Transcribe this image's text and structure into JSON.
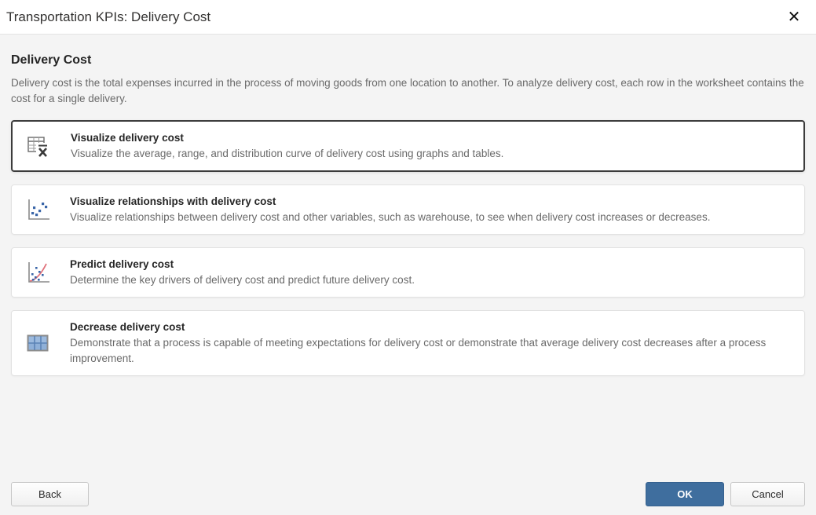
{
  "dialog": {
    "title": "Transportation KPIs: Delivery Cost",
    "close_icon": "close-x"
  },
  "content": {
    "heading": "Delivery Cost",
    "description": "Delivery cost is the total expenses incurred in the process of moving goods from one location to another. To analyze delivery cost, each row in the worksheet contains the cost for a single delivery.",
    "options": [
      {
        "icon": "table-mean-icon",
        "title": "Visualize delivery cost",
        "description": "Visualize the average, range, and distribution curve of delivery cost using graphs and tables.",
        "selected": true
      },
      {
        "icon": "scatter-plot-icon",
        "title": "Visualize relationships with delivery cost",
        "description": "Visualize relationships between delivery cost and other variables, such as warehouse, to see when delivery cost increases or decreases.",
        "selected": false
      },
      {
        "icon": "regression-plot-icon",
        "title": "Predict delivery cost",
        "description": "Determine the key drivers of delivery cost and predict future delivery cost.",
        "selected": false
      },
      {
        "icon": "capability-table-icon",
        "title": "Decrease delivery cost",
        "description": "Demonstrate that a process is capable of meeting expectations for delivery cost or demonstrate that average delivery cost decreases after a process improvement.",
        "selected": false
      }
    ]
  },
  "footer": {
    "back_label": "Back",
    "ok_label": "OK",
    "cancel_label": "Cancel"
  },
  "colors": {
    "accent_blue": "#3f6e9e",
    "selected_card_border": "#3c3c3c",
    "scatter_dot_blue": "#3a66a8",
    "regression_line_red": "#e0707a",
    "table_fill_blue": "#8fb0d8",
    "icon_gray": "#6a6a6a"
  }
}
